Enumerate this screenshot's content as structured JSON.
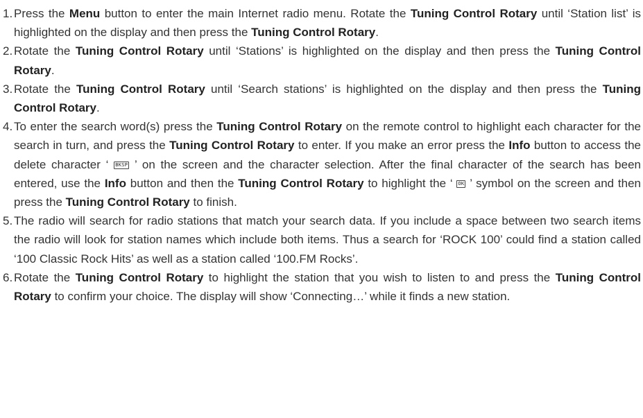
{
  "steps": [
    {
      "num": "1.",
      "parts": [
        {
          "t": "Press the "
        },
        {
          "b": "Menu"
        },
        {
          "t": " button to enter the main Internet radio menu. Rotate the "
        },
        {
          "b": "Tuning Control Rotary"
        },
        {
          "t": " until ‘Station list’ is highlighted on the display and then press the "
        },
        {
          "b": "Tuning Control Rotary"
        },
        {
          "t": "."
        }
      ]
    },
    {
      "num": "2.",
      "parts": [
        {
          "t": "Rotate the "
        },
        {
          "b": "Tuning Control Rotary"
        },
        {
          "t": " until ‘Stations’ is highlighted on the display and then press the "
        },
        {
          "b": "Tuning Control Rotary"
        },
        {
          "t": "."
        }
      ]
    },
    {
      "num": "3.",
      "parts": [
        {
          "t": "Rotate the "
        },
        {
          "b": "Tuning Control Rotary"
        },
        {
          "t": " until ‘Search stations’ is highlighted on the display and then press the "
        },
        {
          "b": "Tuning Control Rotary"
        },
        {
          "t": "."
        }
      ]
    },
    {
      "num": "4.",
      "parts": [
        {
          "t": "To enter the search word(s) press the "
        },
        {
          "b": "Tuning Control Rotary"
        },
        {
          "t": " on the remote control to highlight each character for the search in turn, and press the "
        },
        {
          "b": "Tuning Control Rotary"
        },
        {
          "t": " to enter. If you make an error press the "
        },
        {
          "b": "Info"
        },
        {
          "t": " button to access the delete character ‘ "
        },
        {
          "k": "BKSP"
        },
        {
          "t": " ’ on the screen and the character selection. After the final character of the search has been entered, use the "
        },
        {
          "b": "Info"
        },
        {
          "t": " button and then the "
        },
        {
          "b": "Tuning Control Rotary"
        },
        {
          "t": " to highlight the ‘ "
        },
        {
          "k": "OK"
        },
        {
          "t": " ’ symbol on the screen and then press the "
        },
        {
          "b": "Tuning Control Rotary"
        },
        {
          "t": " to finish."
        }
      ]
    },
    {
      "num": "5.",
      "parts": [
        {
          "t": "The radio will search for radio stations that match your search data. If you include a space between two search items the radio will look for station names which include both items. Thus a search for ‘ROCK 100’ could find a station called ‘100 Classic Rock Hits’ as well as a station called ‘100.FM Rocks’."
        }
      ]
    },
    {
      "num": "6.",
      "parts": [
        {
          "t": "Rotate the "
        },
        {
          "b": "Tuning Control Rotary"
        },
        {
          "t": " to highlight the station that you wish to listen to and press the "
        },
        {
          "b": "Tuning Control Rotary"
        },
        {
          "t": " to confirm your choice. The display will show ‘Connecting…’ while it finds a new station."
        }
      ]
    }
  ]
}
